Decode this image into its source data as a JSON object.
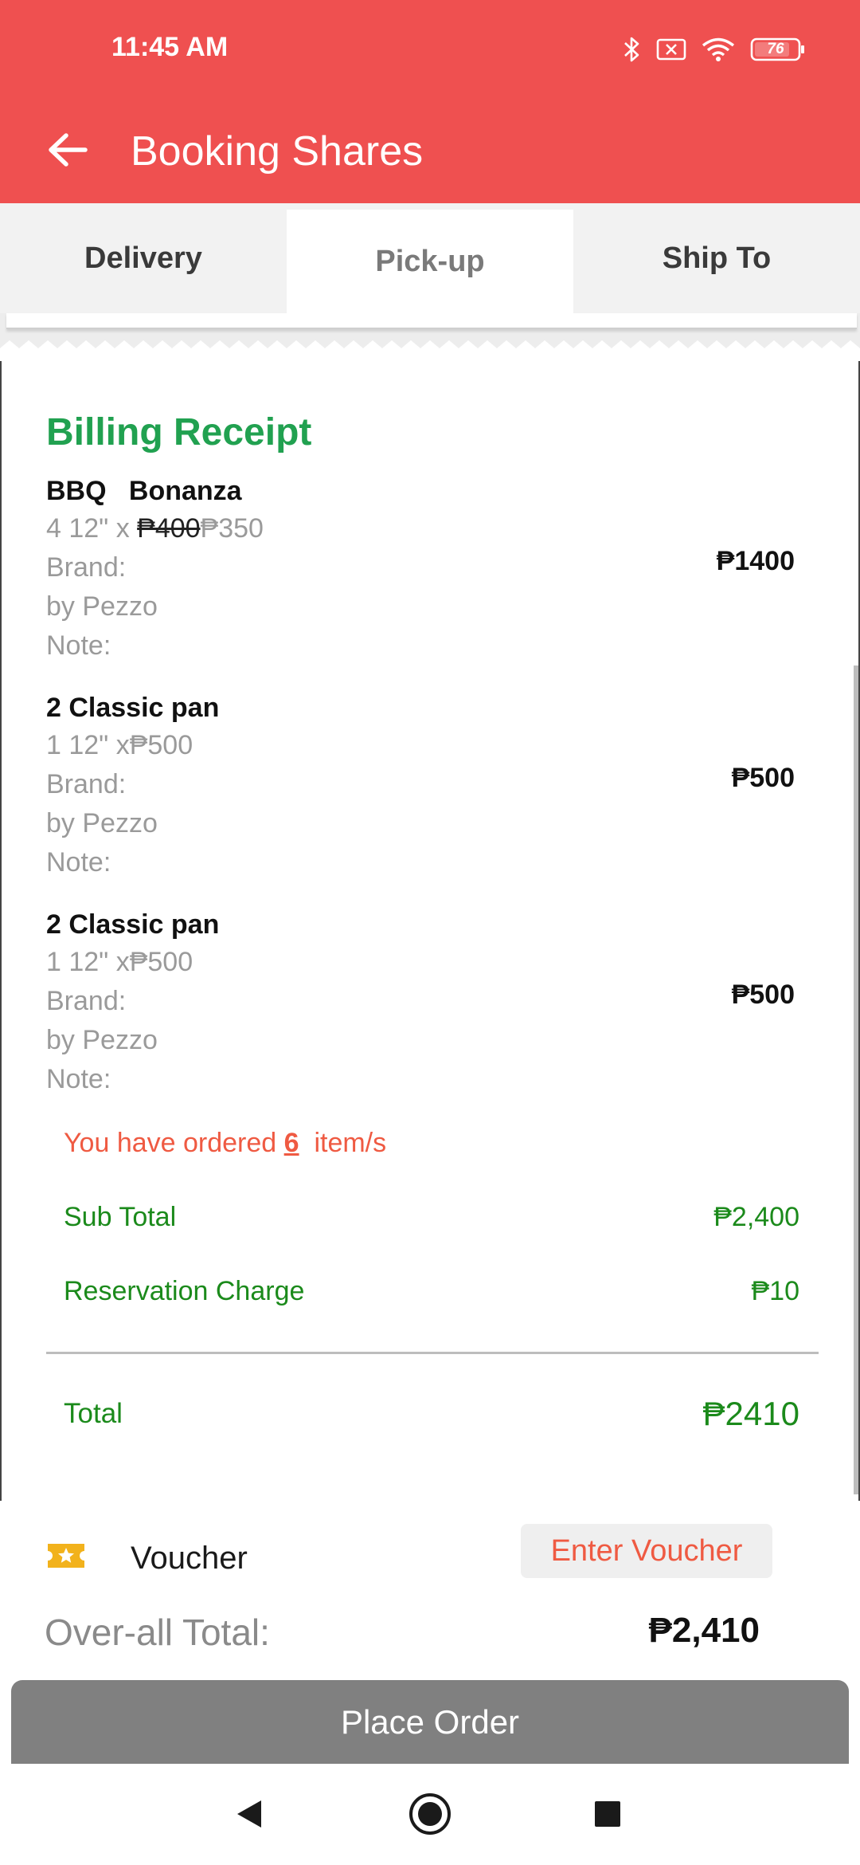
{
  "status_bar": {
    "time": "11:45 AM",
    "battery": "76",
    "icons": [
      "bluetooth-icon",
      "no-sim-icon",
      "wifi-icon",
      "battery-icon"
    ]
  },
  "app_bar": {
    "title": "Booking Shares",
    "back_icon": "arrow-left-icon"
  },
  "tabs": [
    {
      "label": "Delivery",
      "active": false
    },
    {
      "label": "Pick-up",
      "active": true
    },
    {
      "label": "Ship To",
      "active": false
    }
  ],
  "receipt": {
    "title": "Billing Receipt",
    "items": [
      {
        "name": "BBQ   Bonanza",
        "qty_size": "4 12\" x ",
        "old_price": "₱400",
        "unit_price": "₱350",
        "brand_label": "Brand:",
        "brand": "by Pezzo",
        "note_label": "Note:",
        "total": "₱1400"
      },
      {
        "name": "2 Classic pan",
        "qty_size": "1 12\" x",
        "unit_price": "₱500",
        "brand_label": "Brand:",
        "brand": "by Pezzo",
        "note_label": "Note:",
        "total": "₱500"
      },
      {
        "name": "2 Classic pan",
        "qty_size": "1 12\" x",
        "unit_price": "₱500",
        "brand_label": "Brand:",
        "brand": "by Pezzo",
        "note_label": "Note:",
        "total": "₱500"
      }
    ],
    "ordered_prefix": "You have ordered ",
    "ordered_count": "6",
    "ordered_suffix": "  item/s",
    "subtotal_label": "Sub Total",
    "subtotal_value": "₱2,400",
    "reservation_label": "Reservation Charge",
    "reservation_value": "₱10",
    "total_label": "Total",
    "total_value": "₱2410"
  },
  "voucher": {
    "label": "Voucher",
    "button": "Enter Voucher",
    "icon": "ticket-star-icon",
    "icon_color": "#f2b21c"
  },
  "overall": {
    "label": "Over-all Total:",
    "value": "₱2,410"
  },
  "place_order": {
    "label": "Place Order"
  },
  "colors": {
    "primary": "#ef5050",
    "receipt_title": "#21a150",
    "summary_green": "#1b8a1b",
    "accent_orange": "#ef5a42",
    "button_gray": "#808080"
  }
}
